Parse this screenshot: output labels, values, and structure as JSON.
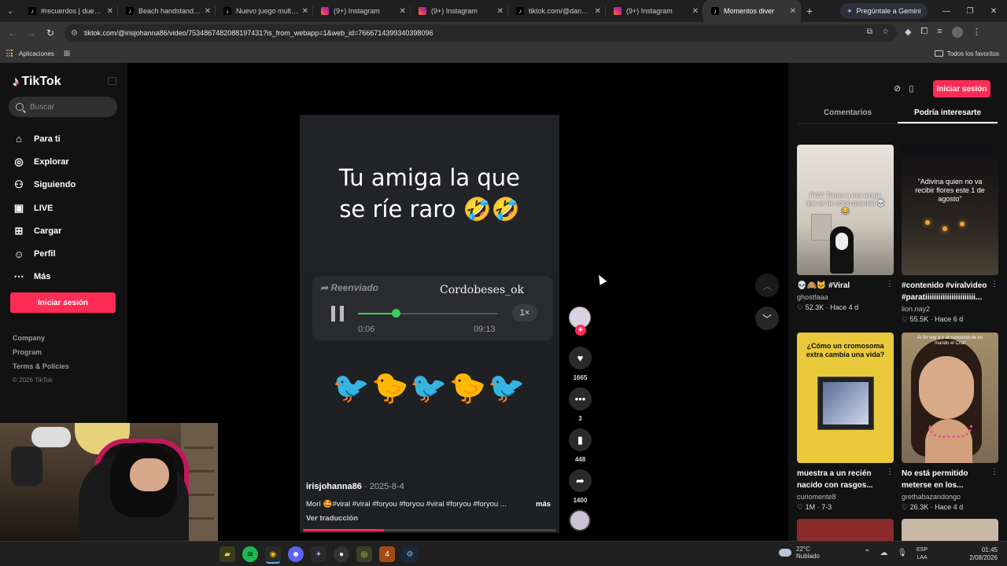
{
  "browser": {
    "tabs": [
      {
        "title": "#recuerdos | duende",
        "icon": "tiktok-icon"
      },
      {
        "title": "Beach handstands | T",
        "icon": "tiktok-icon"
      },
      {
        "title": "Nuevo juego multijug",
        "icon": "tiktok-icon"
      },
      {
        "title": "(9+) Instagram",
        "icon": "instagram-icon"
      },
      {
        "title": "(9+) Instagram",
        "icon": "instagram-icon"
      },
      {
        "title": "tiktok.com/@danyah",
        "icon": "tiktok-icon"
      },
      {
        "title": "(9+) Instagram",
        "icon": "instagram-icon"
      },
      {
        "title": "Momentos diver",
        "icon": "tiktok-icon",
        "active": true
      }
    ],
    "gemini_label": "Pregúntale a Gemini",
    "url": "tiktok.com/@irisjohanna86/video/7534867482088197431?is_from_webapp=1&web_id=7666714399340398096",
    "bookmarks": {
      "apps": "Aplicaciones",
      "all": "Todos los favoritos"
    }
  },
  "sidebar": {
    "brand": "TikTok",
    "search_placeholder": "Buscar",
    "items": [
      {
        "label": "Para ti",
        "icon": "home-icon"
      },
      {
        "label": "Explorar",
        "icon": "compass-icon"
      },
      {
        "label": "Siguiendo",
        "icon": "user-follow-icon"
      },
      {
        "label": "LIVE",
        "icon": "live-icon"
      },
      {
        "label": "Cargar",
        "icon": "upload-icon"
      },
      {
        "label": "Perfil",
        "icon": "profile-icon"
      },
      {
        "label": "Más",
        "icon": "more-icon"
      }
    ],
    "login": "Iniciar sesión",
    "footer": [
      "Company",
      "Program",
      "Terms & Policies"
    ],
    "copyright": "© 2026 TikTok"
  },
  "video": {
    "caption_line1": "Tu amiga la que",
    "caption_line2": "se ríe raro 🤣🤣",
    "forwarded": "Reenviado",
    "voice_user": "Cordobeses_ok",
    "elapsed": "0:06",
    "duration": "09:13",
    "speed": "1×",
    "audio_progress": 0.27,
    "birds": "🐦🐤🐦🐤🐦",
    "author": "irisjohanna86",
    "date": "2025-8-4",
    "description": "Morí 🤩#viral #viral #foryou #foryou #viral #foryou #foryou ...",
    "more": "más",
    "translate": "Ver traducción",
    "progress": 0.32
  },
  "actions": {
    "likes": "1665",
    "comments": "3",
    "saves": "448",
    "shares": "1400"
  },
  "right_panel": {
    "login": "Iniciar sesión",
    "tabs": [
      "Comentarios",
      "Podría interesarte"
    ],
    "active_tab": 1,
    "cards": [
      {
        "title": "💀🙈🐱 #Viral",
        "author": "ghostfaaa",
        "likes": "52.3K",
        "when": "Hace 4 d",
        "thumb_text": "POV: Tienes a esa amiga que se ríe como poseída 💀😂"
      },
      {
        "title": "#contenido #viralvideo #paratiiiiiiiiiiiiiiiiiiiiiii...",
        "author": "lion.nay2",
        "likes": "55.5K",
        "when": "Hace 6 d",
        "thumb_text": "\"Adivina quien no va recibir flores este 1 de agosto\""
      },
      {
        "title": "muestra a un recién nacido con rasgos...",
        "author": "curiomente8",
        "likes": "1M",
        "when": "7-3",
        "thumb_text": "¿Cómo un cromosoma extra cambia una vida?"
      },
      {
        "title": "No está permitido meterse en los...",
        "author": "grethabazandongo",
        "likes": "26.3K",
        "when": "Hace 4 d",
        "thumb_text": "Al fin voy a ir al concierto de mi marido el Chal"
      }
    ]
  },
  "taskbar": {
    "weather_temp": "22°C",
    "weather_desc": "Nublado",
    "lang1": "ESP",
    "lang2": "LAA",
    "time": "01:45",
    "date": "2/08/2026"
  }
}
